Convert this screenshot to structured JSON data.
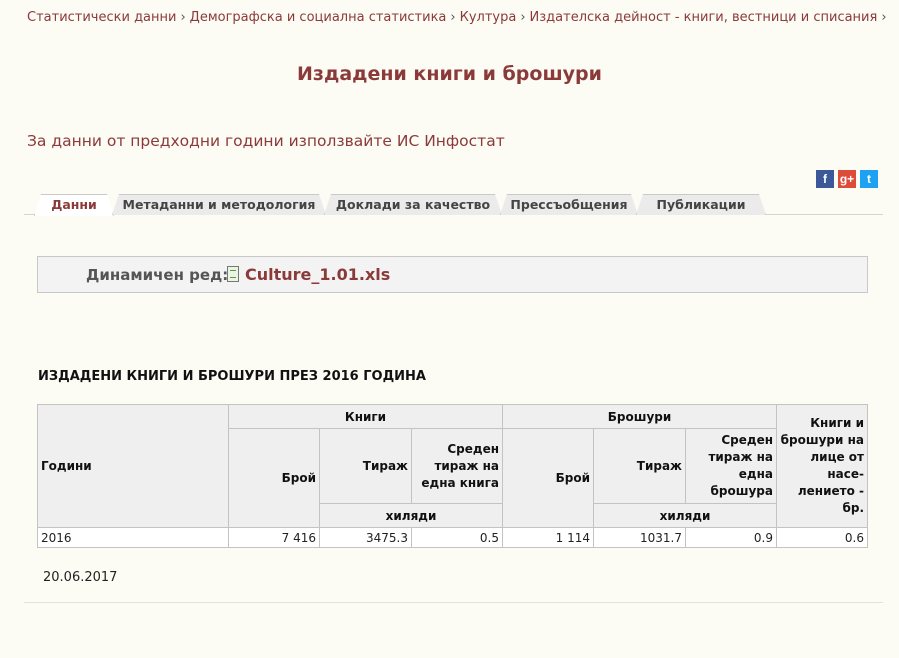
{
  "breadcrumb": [
    "Статистически данни",
    "Демографска и социална статистика",
    "Култура",
    "Издателска дейност - книги, вестници и списания"
  ],
  "breadcrumb_separator": "›",
  "page_title": "Издадени книги и брошури",
  "infostat_link": "За данни от предходни години използвайте ИС Инфостат",
  "social": {
    "facebook": "f",
    "google_plus": "g+",
    "twitter": "t"
  },
  "tabs": [
    "Данни",
    "Метаданни и методология",
    "Доклади за качество",
    "Прессъобщения",
    "Публикации"
  ],
  "active_tab": "Данни",
  "dynamic_series": {
    "label": "Динамичен ред:",
    "file": "Culture_1.01.xls"
  },
  "table": {
    "title": "ИЗДАДЕНИ КНИГИ И БРОШУРИ ПРЕЗ 2016 ГОДИНА",
    "headers": {
      "years": "Години",
      "books": "Книги",
      "brochures": "Брошури",
      "count": "Брой",
      "circulation": "Тираж",
      "avg_book": "Среден тираж на една книга",
      "avg_brochure": "Среден тираж на една брошура",
      "per_capita": "Книги и брошури на лице от насе-лението - бр.",
      "thousands": "хиляди"
    },
    "rows": [
      {
        "year": "2016",
        "books_count": "7 416",
        "books_circ": "3475.3",
        "books_avg": "0.5",
        "broch_count": "1 114",
        "broch_circ": "1031.7",
        "broch_avg": "0.9",
        "per_capita": "0.6"
      }
    ]
  },
  "date": "20.06.2017"
}
